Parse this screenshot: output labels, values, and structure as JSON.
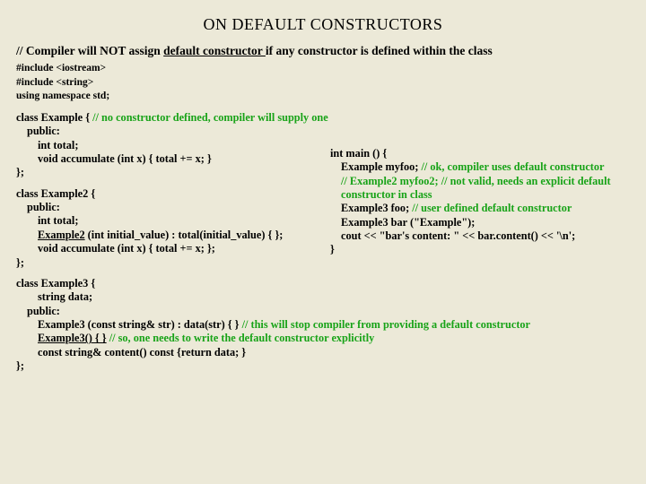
{
  "title": "ON DEFAULT CONSTRUCTORS",
  "subtitle_pre": "// Compiler will NOT assign ",
  "subtitle_u": "default constructor ",
  "subtitle_post": "if any constructor is defined within the class",
  "inc1": "#include <iostream>",
  "inc2": "#include <string>",
  "inc3": "using namespace std;",
  "ex1_l1a": "class Example {   ",
  "ex1_l1b": "// no constructor defined, compiler will supply one",
  "ex1_l2": "public:",
  "ex1_l3": "int  total;",
  "ex1_l4": "void  accumulate (int x) { total += x; }",
  "ex1_l5": "};",
  "ex2_l1": "class Example2 {",
  "ex2_l2": "public:",
  "ex2_l3": "int  total;",
  "ex2_l4a": "Example2",
  "ex2_l4b": "  (int initial_value) : total(initial_value) { };",
  "ex2_l5": "void  accumulate (int x) { total += x; };",
  "ex2_l6": "};",
  "ex3_l1": "class Example3 {",
  "ex3_l2": "string  data;",
  "ex3_l3": "public:",
  "ex3_l4a": "Example3 (const string& str) : data(str) { } ",
  "ex3_l4b": "// this will stop compiler from providing a default constructor",
  "ex3_l5a": "Example3() { }",
  "ex3_l5b": " // so, one needs to write the default constructor explicitly",
  "ex3_l6": "const  string&  content()  const {return data; }",
  "ex3_l7": "};",
  "m1": "int main () {",
  "m2a": "Example  myfoo;  ",
  "m2b": "// ok, compiler uses default constructor",
  "m3a": "// Example2  myfoo2;  ",
  "m3b": "// not valid, needs an explicit default constructor in class",
  "m4a": "Example3  foo;  ",
  "m4b": "// user defined default constructor",
  "m5": "Example3  bar (\"Example\");",
  "m6": "cout << \"bar's content: \" << bar.content() << '\\n';",
  "m7": "}"
}
